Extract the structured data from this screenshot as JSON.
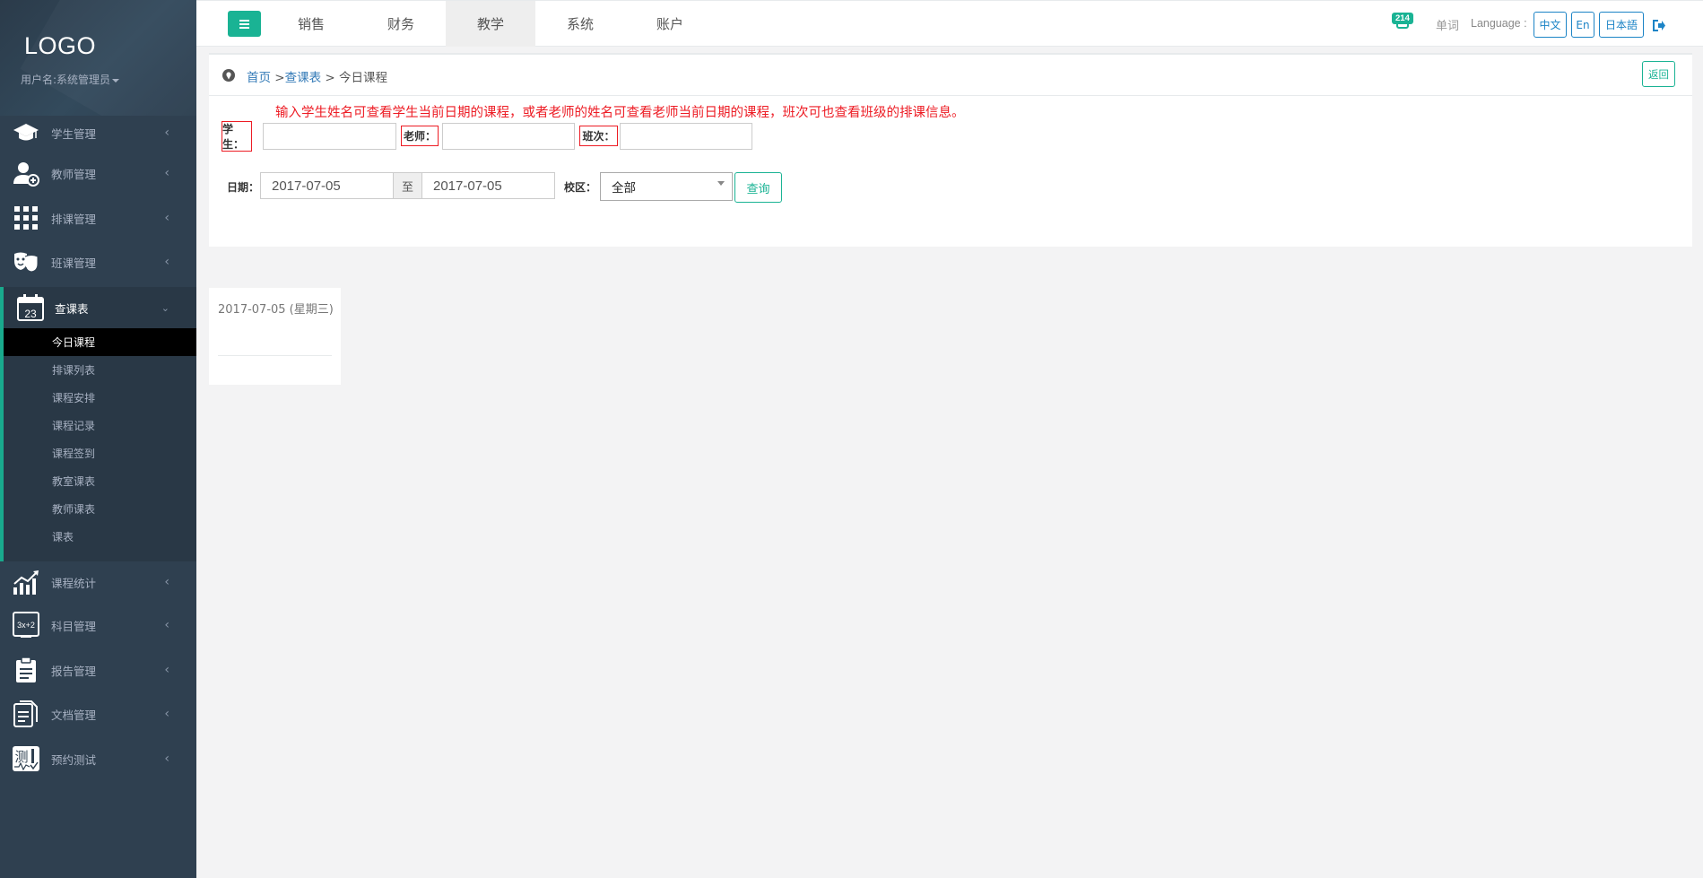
{
  "sidebar": {
    "logo": "LOGO",
    "user": "用户名:系统管理员",
    "items": [
      {
        "label": "学生管理",
        "icon": "graduation-cap-icon"
      },
      {
        "label": "教师管理",
        "icon": "teacher-add-icon"
      },
      {
        "label": "排课管理",
        "icon": "grid-icon"
      },
      {
        "label": "班课管理",
        "icon": "theater-masks-icon"
      },
      {
        "label": "查课表",
        "icon": "calendar-icon",
        "calendar_day": "23"
      },
      {
        "label": "课程统计",
        "icon": "bar-chart-icon"
      },
      {
        "label": "科目管理",
        "icon": "math-board-icon",
        "board_text": "3x+2"
      },
      {
        "label": "报告管理",
        "icon": "clipboard-icon"
      },
      {
        "label": "文档管理",
        "icon": "document-icon"
      },
      {
        "label": "预约测试",
        "icon": "test-icon",
        "test_char": "测"
      }
    ],
    "submenu": [
      "今日课程",
      "排课列表",
      "课程安排",
      "课程记录",
      "课程签到",
      "教室课表",
      "教师课表",
      "课表"
    ]
  },
  "topbar": {
    "tabs": [
      "销售",
      "财务",
      "教学",
      "系统",
      "账户"
    ],
    "active_tab": "教学",
    "notification_count": "214",
    "word_link": "单词",
    "language_label": "Language :",
    "languages": [
      "中文",
      "En",
      "日本語"
    ]
  },
  "breadcrumb": {
    "home": "首页",
    "sep1": " >",
    "section": "查课表",
    "sep2": " > ",
    "current": "今日课程"
  },
  "back_button": "返回",
  "hint": "输入学生姓名可查看学生当前日期的课程，或者老师的姓名可查看老师当前日期的课程，班次可也查看班级的排课信息。",
  "filters": {
    "student_label": "学生：",
    "teacher_label": "老师：",
    "class_label": "班次：",
    "date_label": "日期：",
    "date_from": "2017-07-05",
    "date_sep": "至",
    "date_to": "2017-07-05",
    "campus_label": "校区：",
    "campus_value": "全部",
    "query_button": "查询"
  },
  "day_card": {
    "date": "2017-07-05 (星期三)"
  },
  "colors": {
    "sidebar_bg": "#2f4050",
    "accent": "#1ab394",
    "link": "#337ab7",
    "hint_red": "#ed1c24",
    "lang_blue": "#1c84c6"
  }
}
